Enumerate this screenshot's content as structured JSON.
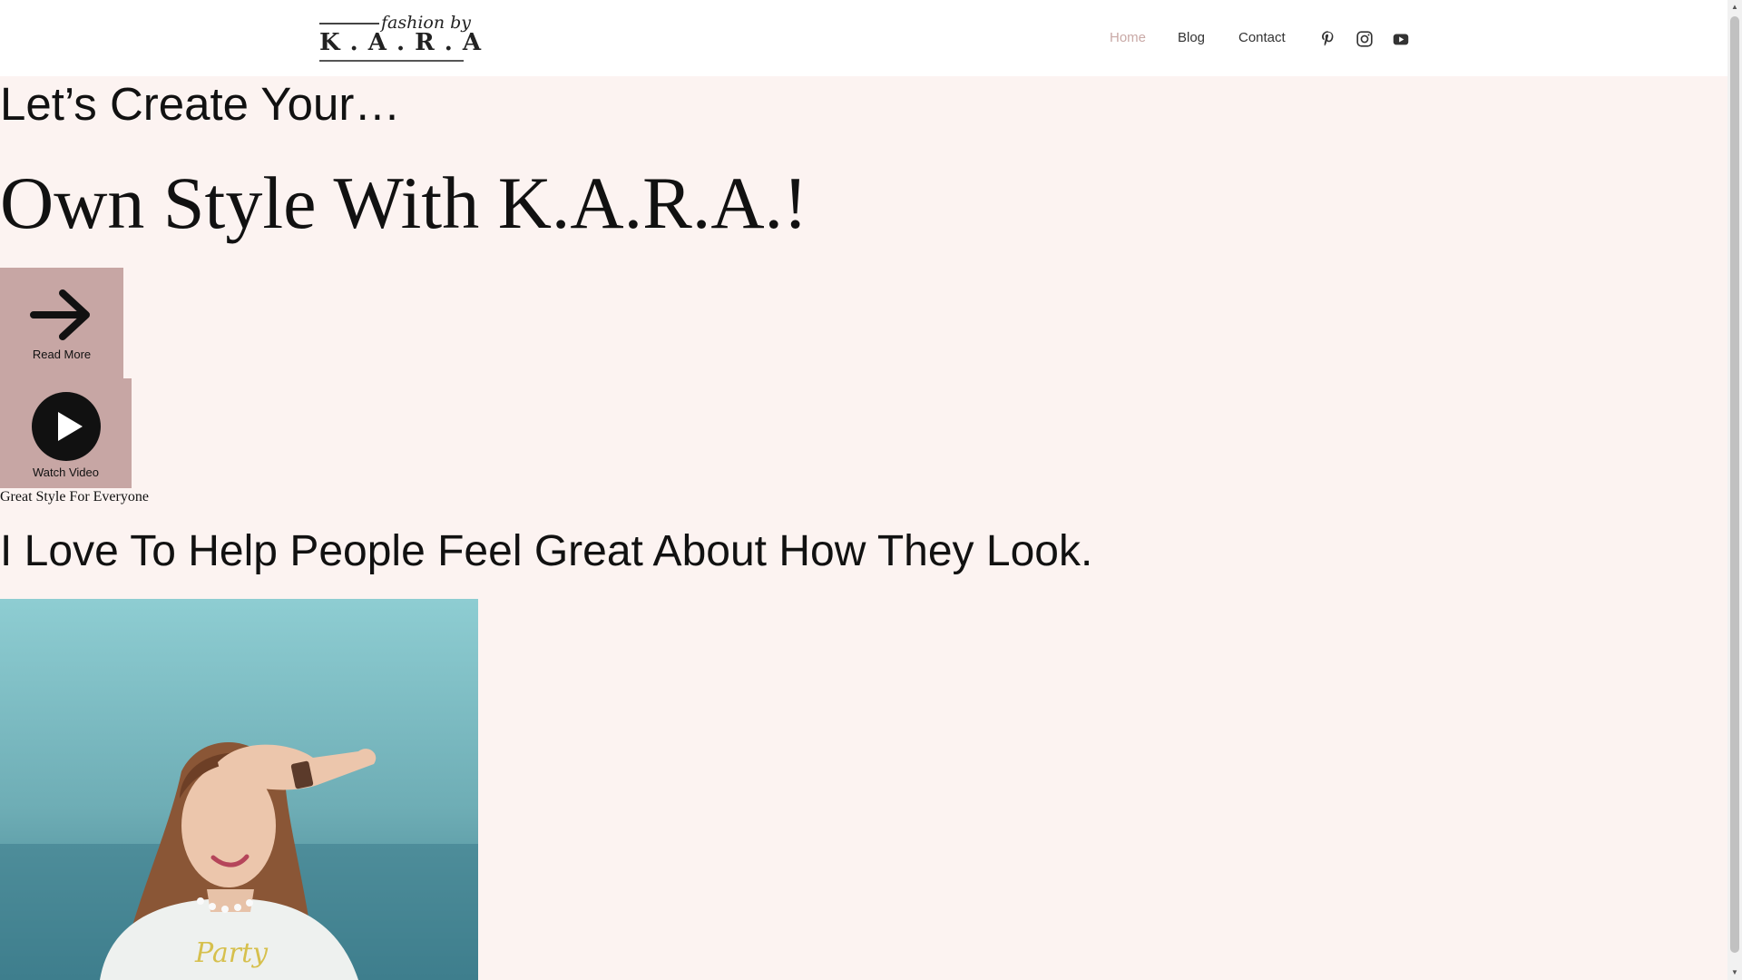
{
  "header": {
    "logo": {
      "script": "fashion by",
      "main": "K . A . R . A"
    },
    "nav": [
      {
        "label": "Home",
        "active": true
      },
      {
        "label": "Blog",
        "active": false
      },
      {
        "label": "Contact",
        "active": false
      }
    ],
    "social": [
      {
        "icon": "pinterest-icon"
      },
      {
        "icon": "instagram-icon"
      },
      {
        "icon": "youtube-icon"
      }
    ]
  },
  "hero": {
    "intro": "Let’s Create Your…",
    "headline": "Own Style With K.A.R.A.!",
    "read_more": {
      "icon": "arrow-right-icon",
      "label": "Read More"
    },
    "watch_video": {
      "icon": "play-icon",
      "label": "Watch Video"
    }
  },
  "about": {
    "tagline": "Great Style For Everyone",
    "headline": "I Love To Help People Feel Great About How They Look.",
    "photo_text": "Party"
  },
  "colors": {
    "page_background": "#fcf3f1",
    "header_background": "#ffffff",
    "button_background": "#c7a6a4",
    "nav_active": "#c9a9a6",
    "text": "#111111"
  }
}
